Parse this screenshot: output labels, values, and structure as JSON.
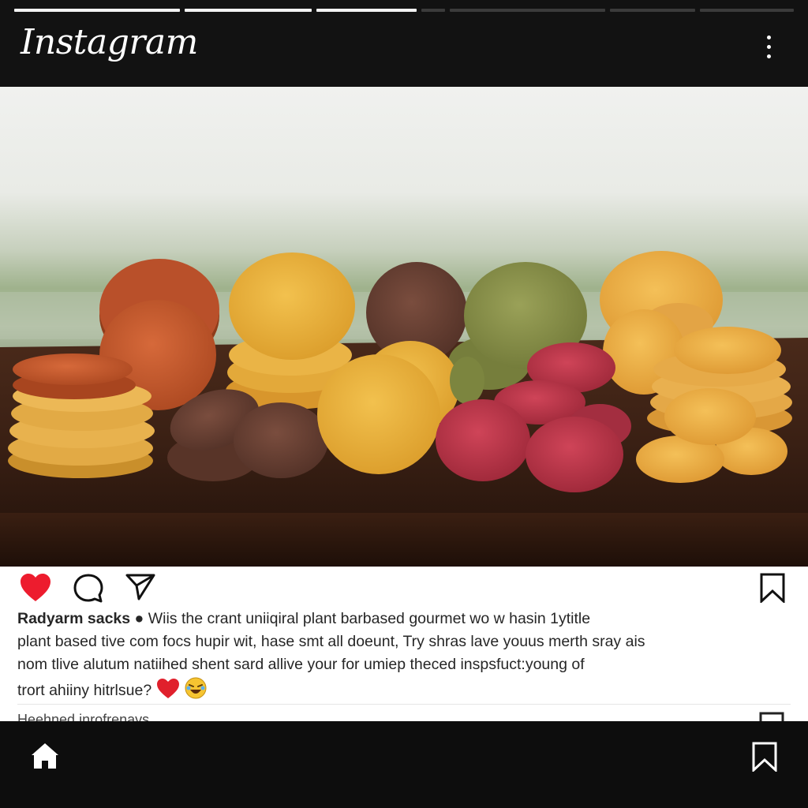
{
  "app": {
    "name": "Instagram"
  },
  "stories": {
    "progress": [
      1,
      1,
      1,
      0,
      0,
      0,
      0
    ]
  },
  "header": {
    "menu_icon": "more-vertical-icon"
  },
  "post": {
    "image_description": "",
    "liked": true,
    "actions": {
      "like_icon": "heart-icon",
      "comment_icon": "comment-icon",
      "share_icon": "send-icon",
      "save_icon": "bookmark-icon"
    },
    "caption": {
      "username": "Radyarm sacks",
      "text_lines": [
        "Wiis the crant uniiqiral plant barbased gourmet wo w hasin 1ytitle",
        "plant based tive com focs hupir wit, hase smt all doeunt, Try shras lave youus merth sray ais",
        "nom tlive alutum natiihed shent sard allive your for umiep theced inspsfuct:young of",
        "trort ahiiny hitrlsue?"
      ]
    },
    "next_post_preview": "Heehned inrofrenavs"
  },
  "bottom_nav": {
    "home_icon": "home-icon",
    "saved_icon": "bookmark-icon"
  },
  "colors": {
    "like": "#ed1c2e",
    "bar_bg": "#121212"
  }
}
